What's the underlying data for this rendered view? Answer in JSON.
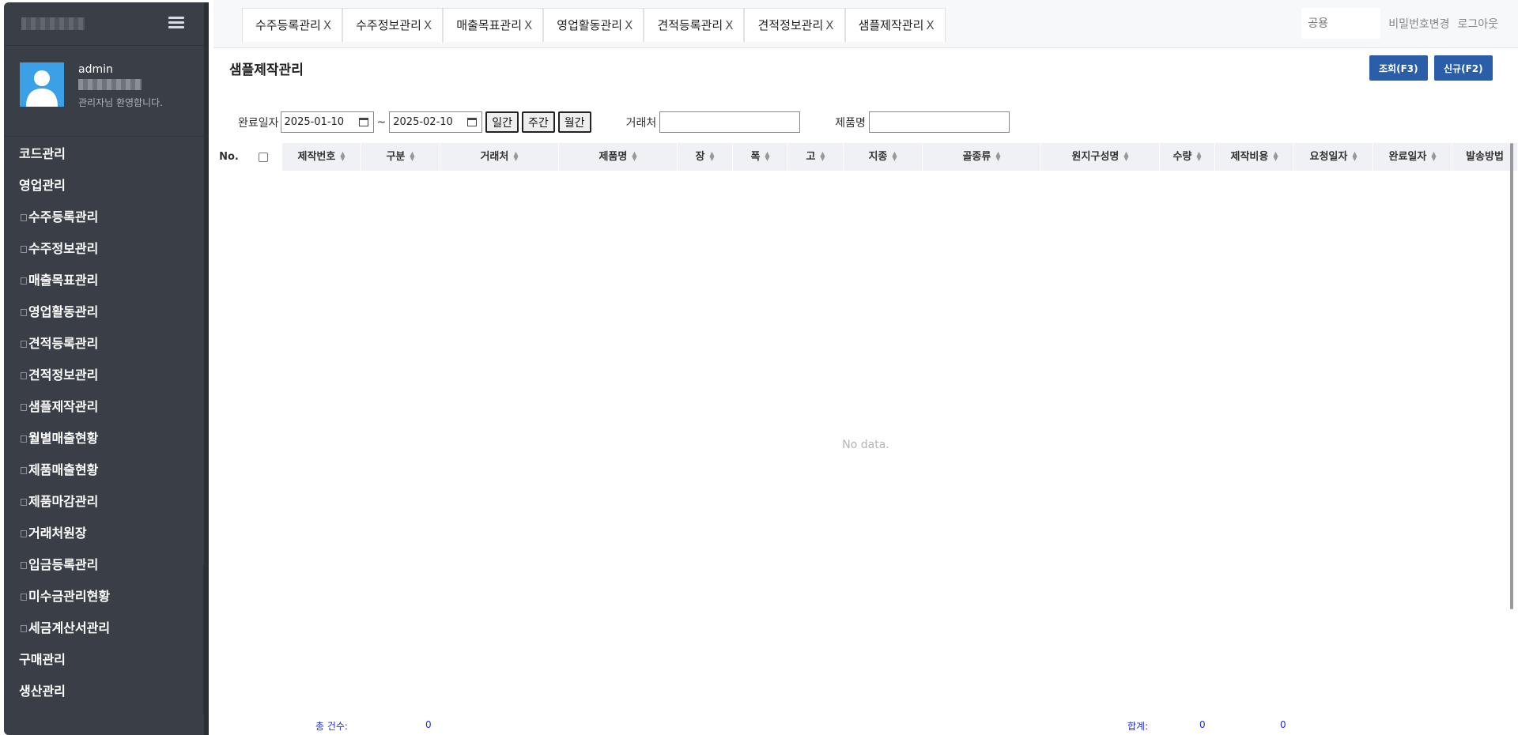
{
  "sidebar": {
    "user": {
      "name": "admin",
      "welcome": "관리자님 환영합니다."
    },
    "menu": [
      {
        "label": "코드관리",
        "sub": false
      },
      {
        "label": "영업관리",
        "sub": false
      },
      {
        "label": "수주등록관리",
        "sub": true
      },
      {
        "label": "수주정보관리",
        "sub": true
      },
      {
        "label": "매출목표관리",
        "sub": true
      },
      {
        "label": "영업활동관리",
        "sub": true
      },
      {
        "label": "견적등록관리",
        "sub": true
      },
      {
        "label": "견적정보관리",
        "sub": true
      },
      {
        "label": "샘플제작관리",
        "sub": true
      },
      {
        "label": "월별매출현황",
        "sub": true
      },
      {
        "label": "제품매출현황",
        "sub": true
      },
      {
        "label": "제품마감관리",
        "sub": true
      },
      {
        "label": "거래처원장",
        "sub": true
      },
      {
        "label": "입금등록관리",
        "sub": true
      },
      {
        "label": "미수금관리현황",
        "sub": true
      },
      {
        "label": "세금계산서관리",
        "sub": true
      },
      {
        "label": "구매관리",
        "sub": false
      },
      {
        "label": "생산관리",
        "sub": false
      }
    ]
  },
  "tabs": [
    "수주등록관리",
    "수주정보관리",
    "매출목표관리",
    "영업활동관리",
    "견적등록관리",
    "견적정보관리",
    "샘플제작관리"
  ],
  "tab_close": "X",
  "top": {
    "search_placeholder": "공용",
    "change_password": "비밀번호변경",
    "logout": "로그아웃"
  },
  "page": {
    "title": "샘플제작관리",
    "btn_search": "조회(F3)",
    "btn_new": "신규(F2)"
  },
  "filter": {
    "date_label": "완료일자",
    "date_from": "2025-01-10",
    "tilde": "~",
    "date_to": "2025-02-10",
    "btn_day": "일간",
    "btn_week": "주간",
    "btn_month": "월간",
    "client_label": "거래처",
    "product_label": "제품명"
  },
  "grid": {
    "no_label": "No.",
    "columns": [
      "제작번호",
      "구분",
      "거래처",
      "제품명",
      "장",
      "폭",
      "고",
      "지종",
      "골종류",
      "원지구성명",
      "수량",
      "제작비용",
      "요청일자",
      "완료일자",
      "발송방법"
    ],
    "empty": "No data."
  },
  "footer": {
    "total_label": "총 건수:",
    "total_count": "0",
    "sum_label": "합계:",
    "sum1": "0",
    "sum2": "0"
  }
}
